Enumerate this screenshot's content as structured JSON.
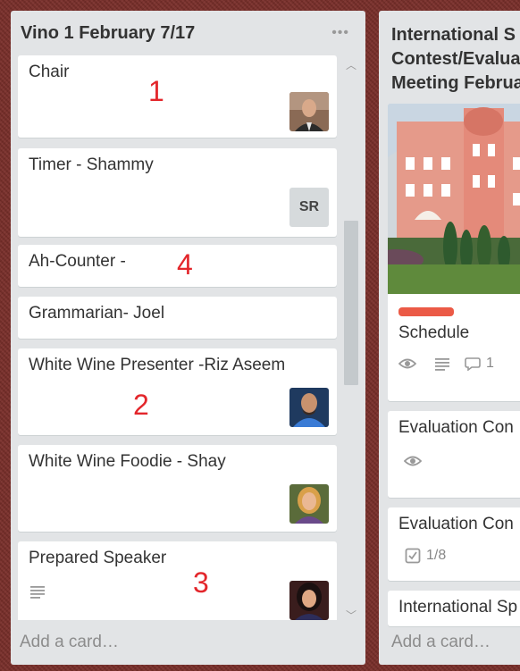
{
  "list1": {
    "title": "Vino 1 February 7/17",
    "more_icon": "ellipsis-icon",
    "add_card": "Add a card…",
    "cards": [
      {
        "title": "Chair",
        "annotation": "1",
        "avatar": "avatar-photo"
      },
      {
        "title": "Timer - Shammy",
        "initials": "SR"
      },
      {
        "title": "Ah-Counter -",
        "annotation": "4"
      },
      {
        "title": "Grammarian- Joel"
      },
      {
        "title": "White Wine Presenter -Riz Aseem",
        "annotation": "2",
        "avatar": "avatar-photo"
      },
      {
        "title": "White Wine Foodie - Shay",
        "avatar": "avatar-photo"
      },
      {
        "title": "Prepared Speaker",
        "annotation": "3",
        "avatar": "avatar-photo",
        "badge_icon": "description-icon"
      }
    ]
  },
  "list2": {
    "title_lines": [
      "International S",
      "Contest/Evalua",
      "Meeting Februa"
    ],
    "add_card": "Add a card…",
    "cards": [
      {
        "title": "Schedule",
        "label_color": "#eb5a46",
        "comments": "1",
        "icons": [
          "eye-icon",
          "description-icon",
          "comment-icon"
        ]
      },
      {
        "title": "Evaluation Con",
        "icons": [
          "eye-icon"
        ]
      },
      {
        "title": "Evaluation Con",
        "checklist": "1/8",
        "icons": [
          "checklist-icon"
        ]
      },
      {
        "title": "International Sp"
      }
    ]
  }
}
